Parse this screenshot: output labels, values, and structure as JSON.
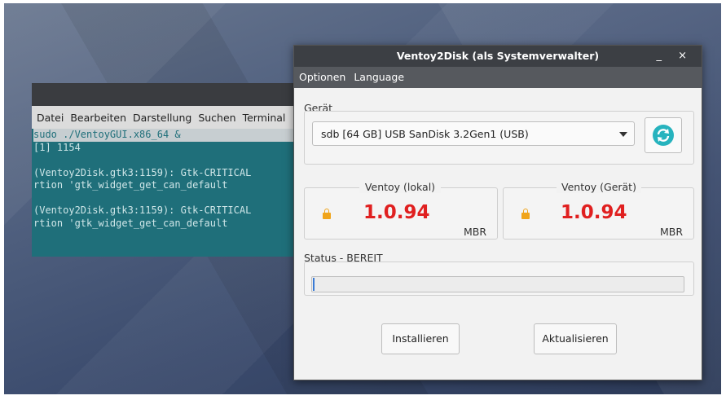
{
  "terminal": {
    "menu": [
      "Datei",
      "Bearbeiten",
      "Darstellung",
      "Suchen",
      "Terminal"
    ],
    "lines": [
      "sudo ./VentoyGUI.x86_64 &",
      "[1] 1154",
      "",
      "(Ventoy2Disk.gtk3:1159): Gtk-CRITICAL",
      "rtion 'gtk_widget_get_can_default",
      "",
      "(Ventoy2Disk.gtk3:1159): Gtk-CRITICAL",
      "rtion 'gtk_widget_get_can_default"
    ]
  },
  "dialog": {
    "title": "Ventoy2Disk (als Systemverwalter)",
    "window_buttons": "_ ×",
    "menu": [
      "Optionen",
      "Language"
    ],
    "device_label": "Gerät",
    "device_selected": "sdb [64 GB]  USB  SanDisk 3.2Gen1 (USB)",
    "local_label": "Ventoy (lokal)",
    "local_version": "1.0.94",
    "local_style": "MBR",
    "device_ver_label": "Ventoy (Gerät)",
    "device_version": "1.0.94",
    "device_style": "MBR",
    "status": "Status - BEREIT",
    "progress": 0,
    "install_label": "Installieren",
    "update_label": "Aktualisieren"
  },
  "colors": {
    "version_text": "#e02020",
    "lock": "#f0a41a",
    "refresh": "#27b3be",
    "terminal_bg": "#1f6f7a"
  },
  "icons": {
    "refresh": "refresh-icon",
    "lock": "lock-icon",
    "dropdown": "chevron-down-icon"
  }
}
